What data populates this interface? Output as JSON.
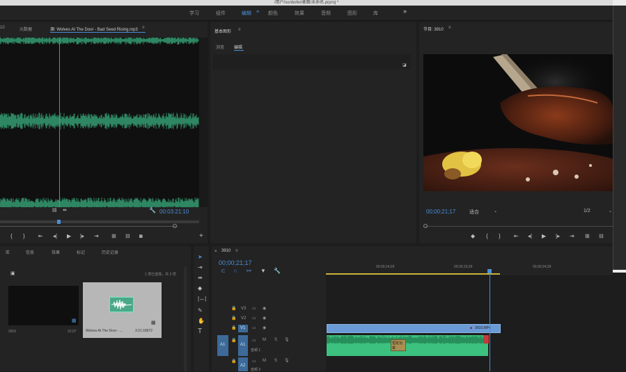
{
  "window": {
    "title": "/用户/sunbofei/桌面/未命名.prproj *"
  },
  "workspaces": {
    "items": [
      "学习",
      "组件",
      "编辑",
      "颜色",
      "效果",
      "音频",
      "图形",
      "库"
    ],
    "active": "编辑",
    "more": "»"
  },
  "source_panel": {
    "tabs": [
      "10",
      "元数据",
      "源: Wolves At The Door - Bad Seed Rising.mp3"
    ],
    "menu_icon": "≡",
    "timecode": "00:03:21:10"
  },
  "essential_graphics": {
    "title": "基本图形",
    "tabs": [
      "浏览",
      "编辑"
    ],
    "active_tab": "编辑"
  },
  "program_panel": {
    "title": "节目: 3910",
    "timecode": "00;00;21;17",
    "fit": "适合",
    "ratio": "1/2"
  },
  "project_panel": {
    "tabs": [
      "库",
      "信息",
      "效果",
      "标记",
      "历史记录"
    ],
    "selection_info": "1 项已选择，共 3 项",
    "items": [
      {
        "name": "3910",
        "duration": "22;07"
      },
      {
        "name": "Wolves At The Door - ...",
        "duration": "3:21:18972"
      }
    ]
  },
  "timeline": {
    "title": "3910",
    "timecode": "00;00;21;17",
    "ruler_ticks": [
      "00;00;14;29",
      "00;00;19;29",
      "00;00;24;29"
    ],
    "tracks": [
      {
        "id": "V3",
        "label": "V3"
      },
      {
        "id": "V2",
        "label": "V2"
      },
      {
        "id": "V1",
        "label": "V1"
      },
      {
        "id": "A1",
        "label": "A1",
        "name": "音频 1"
      },
      {
        "id": "A2",
        "label": "A2",
        "name": "音频 2"
      }
    ],
    "track_source_a1": "A1",
    "video_clip": {
      "label": "3910.MP4"
    },
    "audio_clip": {
      "label": "恒定功率"
    },
    "mute_label": "M",
    "solo_label": "S"
  },
  "colors": {
    "accent": "#4a8fd6",
    "waveform": "#3dbf8a",
    "video_clip": "#6b9bd6",
    "audio_clip": "#3cc17f",
    "panel_bg": "#232323"
  }
}
